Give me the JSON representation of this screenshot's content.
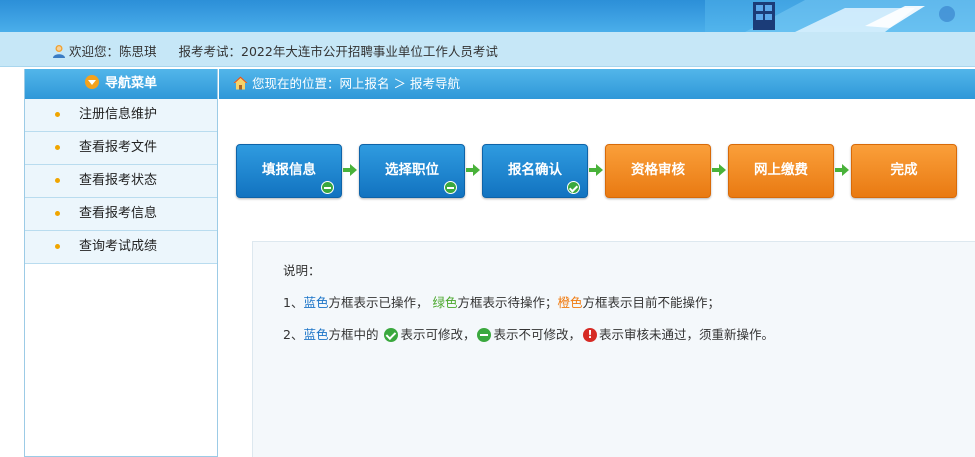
{
  "header": {
    "welcome_text": "欢迎您：陈思琪",
    "exam_text": "报考考试：2022年大连市公开招聘事业单位工作人员考试"
  },
  "sidebar": {
    "title": "导航菜单",
    "items": [
      {
        "label": "注册信息维护"
      },
      {
        "label": "查看报考文件"
      },
      {
        "label": "查看报考状态"
      },
      {
        "label": "查看报考信息"
      },
      {
        "label": "查询考试成绩"
      }
    ]
  },
  "breadcrumb": {
    "text": "您现在的位置：网上报名 ＞ 报考导航"
  },
  "steps": [
    {
      "label": "填报信息",
      "color": "blue",
      "status_icon": "minus-icon"
    },
    {
      "label": "选择职位",
      "color": "blue",
      "status_icon": "minus-icon"
    },
    {
      "label": "报名确认",
      "color": "blue",
      "status_icon": "check-icon"
    },
    {
      "label": "资格审核",
      "color": "orange"
    },
    {
      "label": "网上缴费",
      "color": "orange"
    },
    {
      "label": "完成",
      "color": "orange"
    }
  ],
  "description": {
    "title": "说明：",
    "line1": {
      "prefix": "1、",
      "blue": "蓝色",
      "blue_text": "方框表示已操作，",
      "green": "绿色",
      "green_text": "方框表示待操作；",
      "orange": "橙色",
      "orange_text": "方框表示目前不能操作；"
    },
    "line2": {
      "prefix": "2、",
      "blue": "蓝色",
      "text_a": "方框中的",
      "text_b": "表示可修改，",
      "text_c": "表示不可修改，",
      "text_d": "表示审核未通过，须重新操作。"
    }
  },
  "colors": {
    "blue": "#1a73c7",
    "green": "#4aa82c",
    "orange": "#f07b10",
    "nav": "#2f98d8"
  }
}
